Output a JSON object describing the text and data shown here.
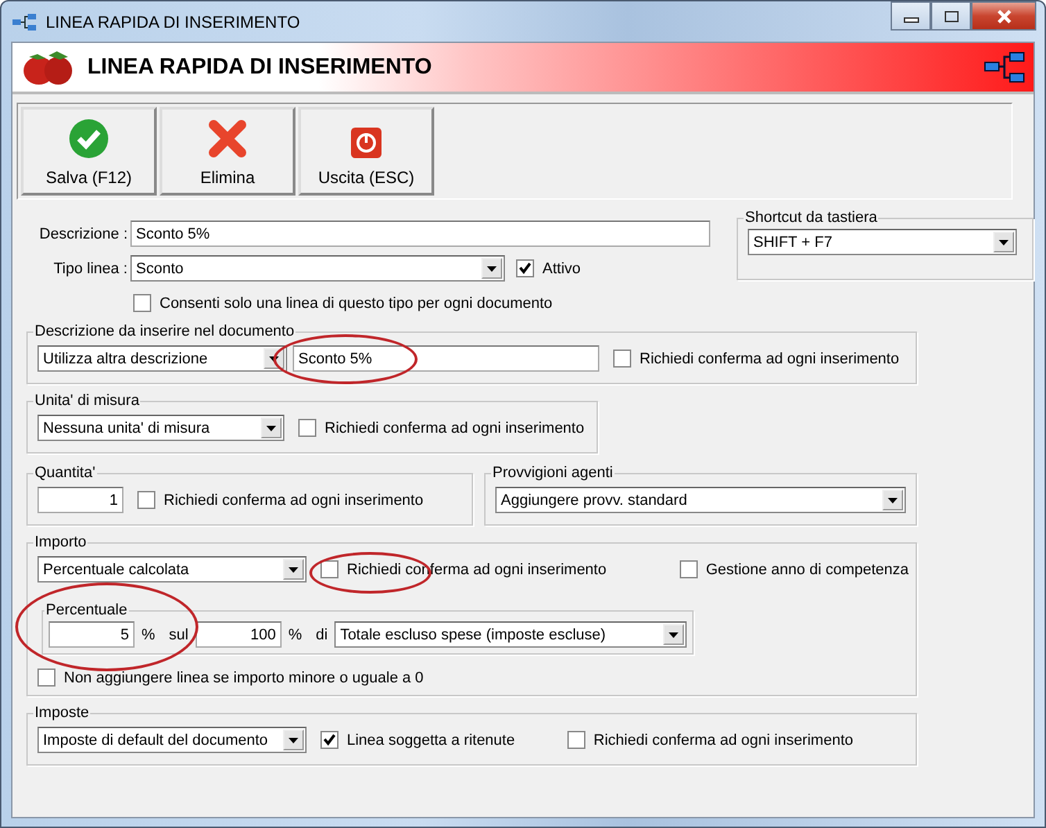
{
  "window": {
    "title": "LINEA RAPIDA DI INSERIMENTO"
  },
  "header": {
    "title": "LINEA RAPIDA DI INSERIMENTO"
  },
  "toolbar": [
    {
      "label": "Salva (F12)",
      "kind": "save"
    },
    {
      "label": "Elimina",
      "kind": "delete"
    },
    {
      "label": "Uscita (ESC)",
      "kind": "exit"
    }
  ],
  "descrizione": {
    "label": "Descrizione :",
    "value": "Sconto 5%"
  },
  "tipo_linea": {
    "label": "Tipo linea :",
    "value": "Sconto"
  },
  "attivo": {
    "label": "Attivo",
    "checked": true
  },
  "consenti": {
    "label": "Consenti solo una linea di questo tipo per ogni documento",
    "checked": false
  },
  "shortcut": {
    "legend": "Shortcut da tastiera",
    "value": "SHIFT + F7"
  },
  "descrizione_documento": {
    "legend": "Descrizione da inserire nel documento",
    "mode": "Utilizza altra descrizione",
    "value": "Sconto 5%",
    "circled": true,
    "confirm": {
      "label": "Richiedi conferma ad ogni inserimento",
      "checked": false
    }
  },
  "unita": {
    "legend": "Unita' di misura",
    "value": "Nessuna unita' di misura",
    "confirm": {
      "label": "Richiedi conferma ad ogni inserimento",
      "checked": false
    }
  },
  "quantita": {
    "legend": "Quantita'",
    "value": "1",
    "confirm": {
      "label": "Richiedi conferma ad ogni inserimento",
      "checked": false
    }
  },
  "provvigioni": {
    "legend": "Provvigioni agenti",
    "value": "Aggiungere provv. standard"
  },
  "importo": {
    "legend": "Importo",
    "mode": "Percentuale calcolata",
    "confirm": {
      "label": "Richiedi conferma ad ogni inserimento",
      "checked": false,
      "circled": true
    },
    "gestione": {
      "label": "Gestione anno di competenza",
      "checked": false
    },
    "percentuale": {
      "legend": "Percentuale",
      "circled": true,
      "value": "5",
      "unit": "%",
      "sul": "sul",
      "base": "100",
      "base_unit": "%",
      "di": "di",
      "of": "Totale escluso spese (imposte escluse)"
    },
    "non_aggiungere": {
      "label": "Non aggiungere linea se importo minore o uguale a 0",
      "checked": false
    }
  },
  "imposte": {
    "legend": "Imposte",
    "value": "Imposte di default del documento",
    "ritenute": {
      "label": "Linea soggetta a ritenute",
      "checked": true
    },
    "confirm": {
      "label": "Richiedi conferma ad ogni inserimento",
      "checked": false
    }
  }
}
